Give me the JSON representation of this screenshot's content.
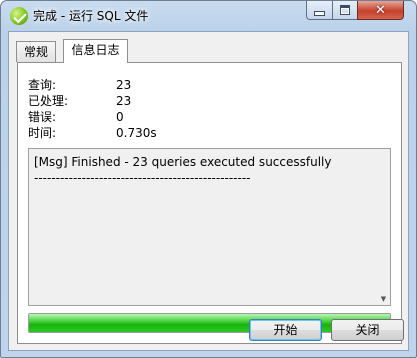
{
  "window": {
    "title": "完成 - 运行 SQL 文件",
    "controls": {
      "minimize": "minimize",
      "maximize": "maximize",
      "close": "✕"
    }
  },
  "tabs": [
    {
      "label": "常规",
      "active": false
    },
    {
      "label": "信息日志",
      "active": true
    }
  ],
  "stats": [
    {
      "label": "查询:",
      "value": "23"
    },
    {
      "label": "已处理:",
      "value": "23"
    },
    {
      "label": "错误:",
      "value": "0"
    },
    {
      "label": "时间:",
      "value": "0.730s"
    }
  ],
  "log": {
    "lines": [
      "[Msg] Finished - 23 queries executed successfully",
      "--------------------------------------------------"
    ]
  },
  "progress": {
    "fraction": 1.0,
    "color": "#17b20e"
  },
  "buttons": {
    "start": "开始",
    "close": "关闭"
  },
  "icons": {
    "app": "navicat-icon",
    "scroll": "scroll-down-arrow-icon"
  }
}
